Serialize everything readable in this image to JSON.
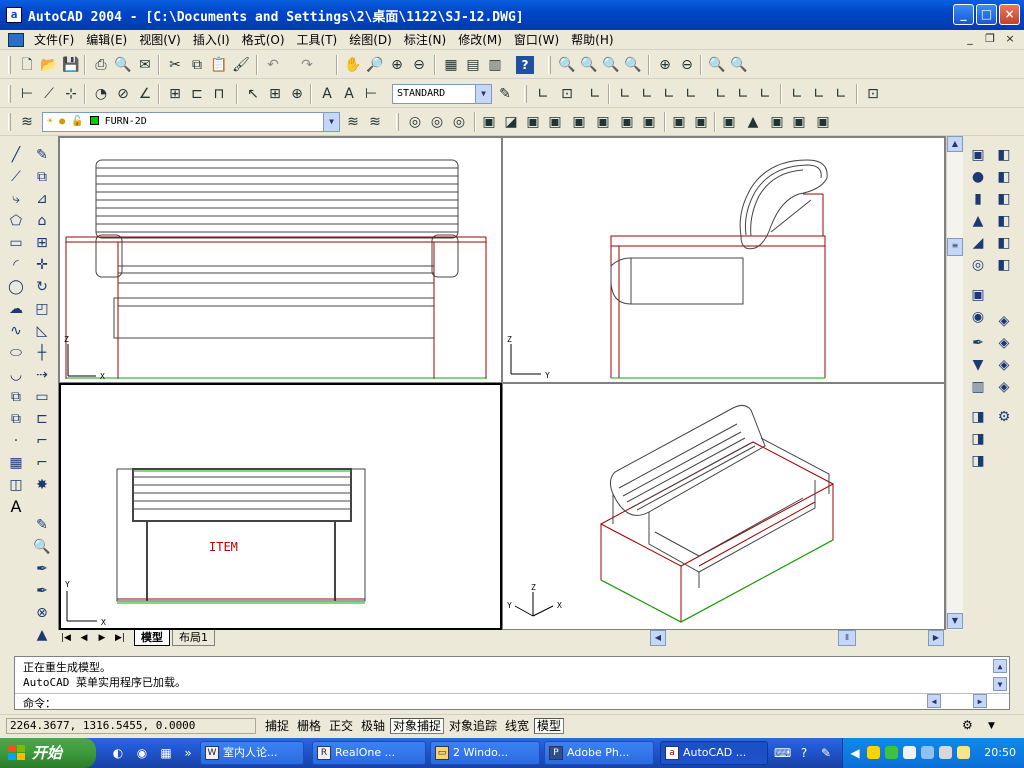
{
  "window": {
    "app_icon": "a",
    "title": "AutoCAD 2004 - [C:\\Documents and Settings\\2\\桌面\\1122\\SJ-12.DWG]",
    "controls": [
      "minimize",
      "maximize",
      "close"
    ]
  },
  "menu": {
    "items": [
      "文件(F)",
      "编辑(E)",
      "视图(V)",
      "插入(I)",
      "格式(O)",
      "工具(T)",
      "绘图(D)",
      "标注(N)",
      "修改(M)",
      "窗口(W)",
      "帮助(H)"
    ]
  },
  "toolbars": {
    "text_style": "STANDARD",
    "layer": "FURN-2D"
  },
  "viewports": {
    "front_axis": {
      "z": "Z",
      "x": "X"
    },
    "side_axis": {
      "z": "Z",
      "y": "Y"
    },
    "top_axis": {
      "y": "Y",
      "x": "X"
    },
    "iso_axis": {
      "z": "Z",
      "y": "Y",
      "x": "X"
    },
    "plan_label": "ITEM"
  },
  "layout_tabs": [
    "模型",
    "布局1"
  ],
  "command": {
    "lines": [
      "正在重生成模型。",
      "AutoCAD 菜单实用程序已加载。"
    ],
    "prompt": "命令："
  },
  "status": {
    "coordinates": "2264.3677, 1316.5455, 0.0000",
    "toggles": [
      {
        "label": "捕捉",
        "on": false
      },
      {
        "label": "栅格",
        "on": false
      },
      {
        "label": "正交",
        "on": false
      },
      {
        "label": "极轴",
        "on": false
      },
      {
        "label": "对象捕捉",
        "on": true
      },
      {
        "label": "对象追踪",
        "on": false
      },
      {
        "label": "线宽",
        "on": false
      },
      {
        "label": "模型",
        "on": true
      }
    ]
  },
  "taskbar": {
    "start_label": "开始",
    "buttons": [
      "室内人论...",
      "RealOne ...",
      "2 Windo...",
      "Adobe Ph...",
      "AutoCAD ..."
    ],
    "clock": "20:50"
  },
  "colors": {
    "title_blue": "#0046c8",
    "taskbar_blue": "#245edb",
    "start_green": "#3c9a3c",
    "drawing_red": "#a00000",
    "drawing_green": "#00b000"
  }
}
